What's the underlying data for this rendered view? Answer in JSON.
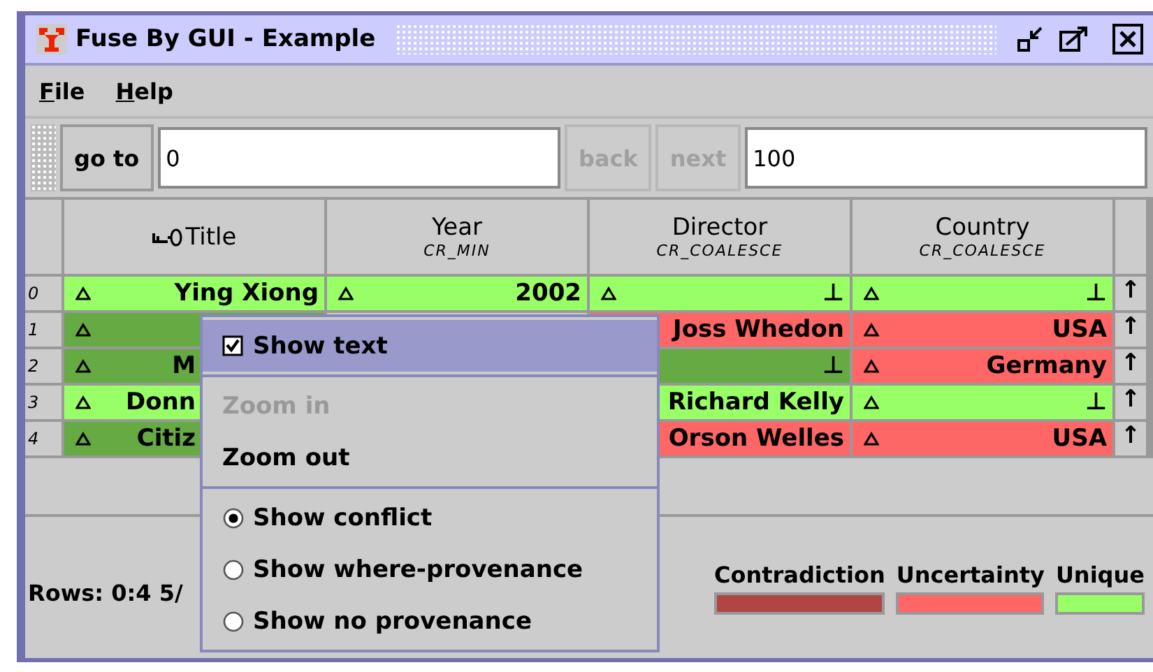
{
  "window": {
    "title": "Fuse By GUI - Example"
  },
  "menu_bar": [
    {
      "label": "File"
    },
    {
      "label": "Help"
    }
  ],
  "toolbar": {
    "goto_button": "go to",
    "start_field": {
      "value": "0"
    },
    "back_button": {
      "label": "back",
      "disabled": true
    },
    "next_button": {
      "label": "next",
      "disabled": true
    },
    "end_field": {
      "value": "100"
    }
  },
  "table": {
    "columns": [
      {
        "title": "Title",
        "key": true
      },
      {
        "title": "Year",
        "strategy": "CR_MIN",
        "key": false
      },
      {
        "title": "Director",
        "strategy": "CR_COALESCE",
        "key": false
      },
      {
        "title": "Country",
        "strategy": "CR_COALESCE",
        "key": false
      }
    ],
    "rows": [
      {
        "index": "0",
        "arrow": "↑",
        "cells": [
          {
            "value": "Ying Xiong",
            "color": "#99ff66"
          },
          {
            "value": "2002",
            "color": "#99ff66"
          },
          {
            "value": "⊥",
            "color": "#99ff66"
          },
          {
            "value": "⊥",
            "color": "#99ff66"
          }
        ]
      },
      {
        "index": "1",
        "arrow": "↑",
        "cells": [
          {
            "color": "#66aa44"
          },
          null,
          {
            "value": "Joss Whedon",
            "color": "#ff6666"
          },
          {
            "value": "USA",
            "color": "#ff6666"
          }
        ]
      },
      {
        "index": "2",
        "arrow": "↑",
        "cells": [
          {
            "value": "M",
            "color": "#66aa44"
          },
          null,
          {
            "value": "⊥",
            "color": "#66aa44"
          },
          {
            "value": "Germany",
            "color": "#ff6666"
          }
        ]
      },
      {
        "index": "3",
        "arrow": "↑",
        "cells": [
          {
            "value": "Donn",
            "color": "#99ff66"
          },
          null,
          {
            "value": "Richard Kelly",
            "color": "#99ff66"
          },
          {
            "value": "⊥",
            "color": "#99ff66"
          }
        ]
      },
      {
        "index": "4",
        "arrow": "↑",
        "cells": [
          {
            "value": "Citiz",
            "color": "#66aa44"
          },
          null,
          {
            "value": "Orson Welles",
            "color": "#ff6666"
          },
          {
            "value": "USA",
            "color": "#ff6666"
          }
        ]
      }
    ]
  },
  "popup_menu": [
    {
      "kind": "check",
      "label": "Show text",
      "checked": true,
      "selected": true,
      "disabled": false
    },
    {
      "kind": "separator"
    },
    {
      "kind": "action",
      "label": "Zoom in",
      "selected": false,
      "disabled": true
    },
    {
      "kind": "action",
      "label": "Zoom out",
      "selected": false,
      "disabled": false
    },
    {
      "kind": "separator"
    },
    {
      "kind": "radio",
      "label": "Show conflict",
      "checked": true,
      "selected": false,
      "disabled": false
    },
    {
      "kind": "radio",
      "label": "Show where-provenance",
      "checked": false,
      "selected": false,
      "disabled": false
    },
    {
      "kind": "radio",
      "label": "Show no provenance",
      "checked": false,
      "selected": false,
      "disabled": false
    }
  ],
  "status": {
    "rows_text": "Rows: 0:4 5/",
    "legend": [
      {
        "label": "Contradiction",
        "color": "#b34444"
      },
      {
        "label": "Uncertainty",
        "color": "#ff6666"
      },
      {
        "label": "Unique",
        "color": "#99ff66"
      }
    ]
  }
}
